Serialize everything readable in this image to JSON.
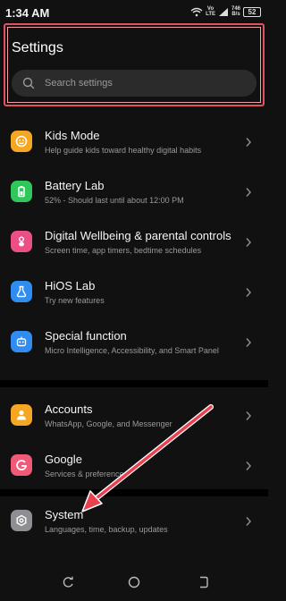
{
  "status_bar": {
    "time": "1:34 AM",
    "volte_top": "Vo",
    "volte_bottom": "LTE",
    "speed_top": "746",
    "speed_bottom": "B/s",
    "battery": "52"
  },
  "header": {
    "title": "Settings",
    "search_placeholder": "Search settings"
  },
  "items": [
    {
      "title": "Kids Mode",
      "subtitle": "Help guide kids toward healthy digital habits",
      "icon": "kids-mode-icon",
      "color": "#f5a623"
    },
    {
      "title": "Battery Lab",
      "subtitle": "52% - Should last until about 12:00 PM",
      "icon": "battery-icon",
      "color": "#2ec85a"
    },
    {
      "title": "Digital Wellbeing & parental controls",
      "subtitle": "Screen time, app timers, bedtime schedules",
      "icon": "wellbeing-icon",
      "color": "#ec4f86"
    },
    {
      "title": "HiOS Lab",
      "subtitle": "Try new features",
      "icon": "flask-icon",
      "color": "#2f8cf0"
    },
    {
      "title": "Special function",
      "subtitle": "Micro Intelligence, Accessibility, and Smart Panel",
      "icon": "robot-icon",
      "color": "#2f8cf0"
    },
    {
      "title": "Accounts",
      "subtitle": "WhatsApp, Google, and Messenger",
      "icon": "account-icon",
      "color": "#f5a623"
    },
    {
      "title": "Google",
      "subtitle": "Services & preferences",
      "icon": "google-icon",
      "color": "#f05a78"
    },
    {
      "title": "System",
      "subtitle": "Languages, time, backup, updates",
      "icon": "system-icon",
      "color": "#8e8e93"
    }
  ],
  "colors": {
    "background": "#111111",
    "highlight": "#e0525e",
    "arrow": "#e8414f"
  }
}
